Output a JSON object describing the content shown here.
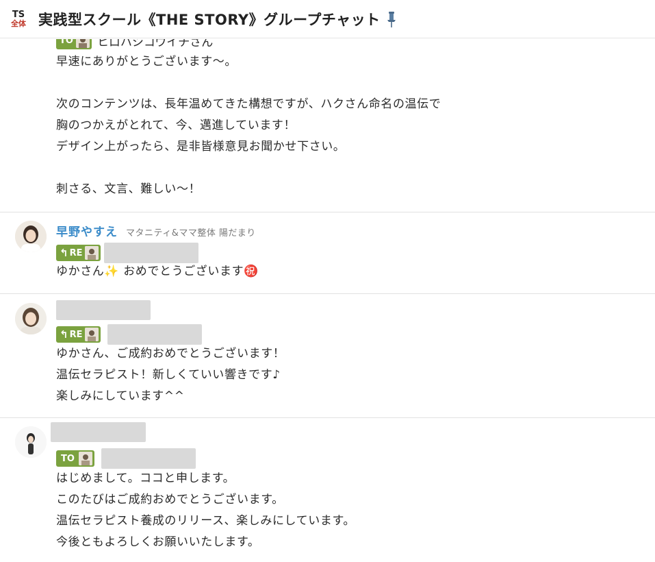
{
  "header": {
    "room_icon_top": "TS",
    "room_icon_bottom": "全体",
    "title": "実践型スクール《THE STORY》グループチャット"
  },
  "messages": [
    {
      "to_label": "TO",
      "to_name_partial": "ヒロハシコウイチさん",
      "lines": [
        "早速にありがとうございます〜。",
        "",
        "次のコンテンツは、長年温めてきた構想ですが、ハクさん命名の温伝で",
        "胸のつかえがとれて、今、邁進しています！",
        "デザイン上がったら、是非皆様意見お聞かせ下さい。",
        "",
        "刺さる、文言、難しい〜！"
      ]
    },
    {
      "sender_name": "早野やすえ",
      "sender_org": "マタニティ&ママ整体 陽だまり",
      "tag_label": "RE",
      "lines_before": "ゆかさん",
      "sparkle": "✨",
      "lines_after": " おめでとうございます㊗️"
    },
    {
      "tag_label": "RE",
      "lines": [
        "ゆかさん、ご成約おめでとうございます！",
        "温伝セラピスト！新しくていい響きです♪",
        "楽しみにしています^^"
      ]
    },
    {
      "tag_label": "TO",
      "lines": [
        "はじめまして。ココと申します。",
        "このたびはご成約おめでとうございます。",
        "温伝セラピスト養成のリリース、楽しみにしています。",
        "今後ともよろしくお願いいたします。"
      ]
    }
  ],
  "colors": {
    "tag_green": "#7ba23f",
    "sender_blue": "#3a8bc9",
    "redaction_gray": "#d9d9d9",
    "divider": "#e1e1e1"
  }
}
